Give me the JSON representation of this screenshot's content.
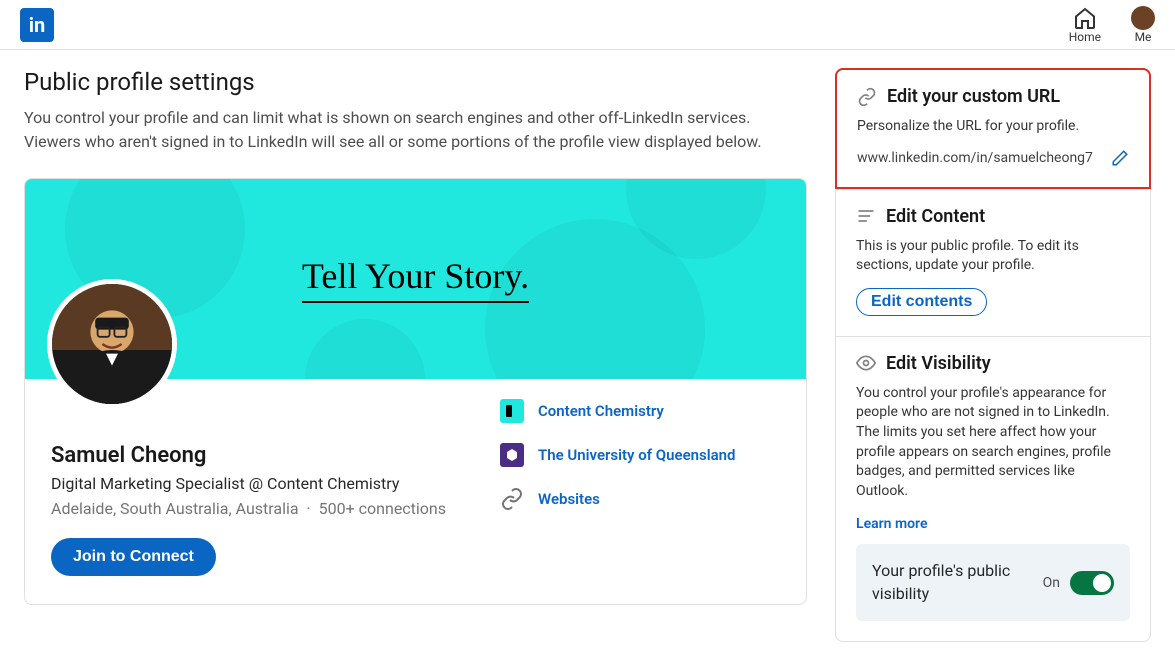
{
  "nav": {
    "home_label": "Home",
    "me_label": "Me"
  },
  "page": {
    "title": "Public profile settings",
    "description": "You control your profile and can limit what is shown on search engines and other off-LinkedIn services. Viewers who aren't signed in to LinkedIn will see all or some portions of the profile view displayed below."
  },
  "profile": {
    "cover_text": "Tell Your Story.",
    "name": "Samuel Cheong",
    "headline": "Digital Marketing Specialist @ Content Chemistry",
    "location": "Adelaide, South Australia, Australia",
    "connections": "500+ connections",
    "connect_button": "Join to Connect",
    "links": [
      {
        "label": "Content Chemistry",
        "logo_color": "#20e8df",
        "icon": "company"
      },
      {
        "label": "The University of Queensland",
        "logo_color": "#4b2e83",
        "icon": "university"
      },
      {
        "label": "Websites",
        "logo_color": "transparent",
        "icon": "link"
      }
    ]
  },
  "url_card": {
    "title": "Edit your custom URL",
    "desc": "Personalize the URL for your profile.",
    "url": "www.linkedin.com/in/samuelcheong7"
  },
  "content_card": {
    "title": "Edit Content",
    "desc": "This is your public profile. To edit its sections, update your profile.",
    "button": "Edit contents"
  },
  "visibility_card": {
    "title": "Edit Visibility",
    "desc": "You control your profile's appearance for people who are not signed in to LinkedIn. The limits you set here affect how your profile appears on search engines, profile badges, and permitted services like Outlook.",
    "learn_more": "Learn more",
    "box_label": "Your profile's public visibility",
    "state": "On"
  }
}
